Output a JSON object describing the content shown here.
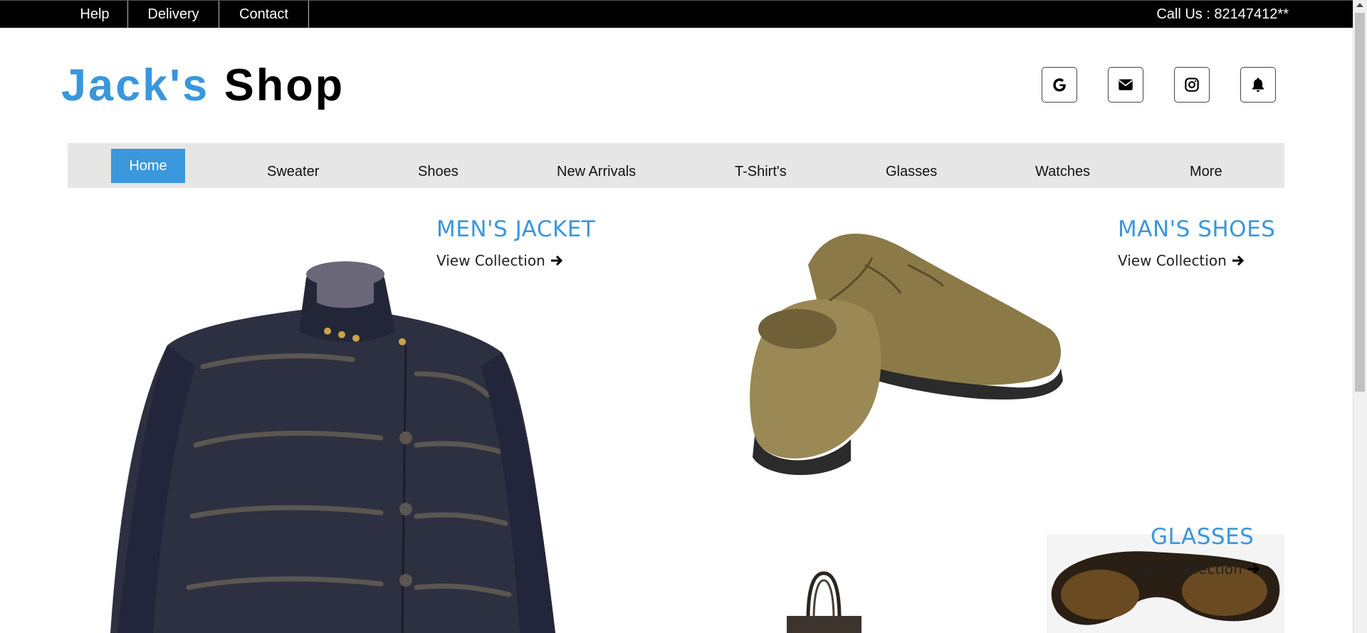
{
  "topbar": {
    "links": [
      "Help",
      "Delivery",
      "Contact"
    ],
    "call_text": "Call Us : 82147412**"
  },
  "header": {
    "logo_first": "Jack's",
    "logo_second": "Shop",
    "social_icons": [
      "google-icon",
      "envelope-icon",
      "instagram-icon",
      "bell-icon"
    ]
  },
  "nav": {
    "items": [
      "Home",
      "Sweater",
      "Shoes",
      "New Arrivals",
      "T-Shirt's",
      "Glasses",
      "Watches",
      "More"
    ],
    "active": "Home"
  },
  "sections": [
    {
      "title": "MEN'S JACKET",
      "link": "View Collection"
    },
    {
      "title": "MAN'S SHOES",
      "link": "View Collection"
    },
    {
      "title": "GLASSES",
      "link": "View Collection"
    }
  ],
  "colors": {
    "accent": "#3a97db",
    "topbar": "#000000",
    "nav_bg": "#e6e6e6"
  }
}
